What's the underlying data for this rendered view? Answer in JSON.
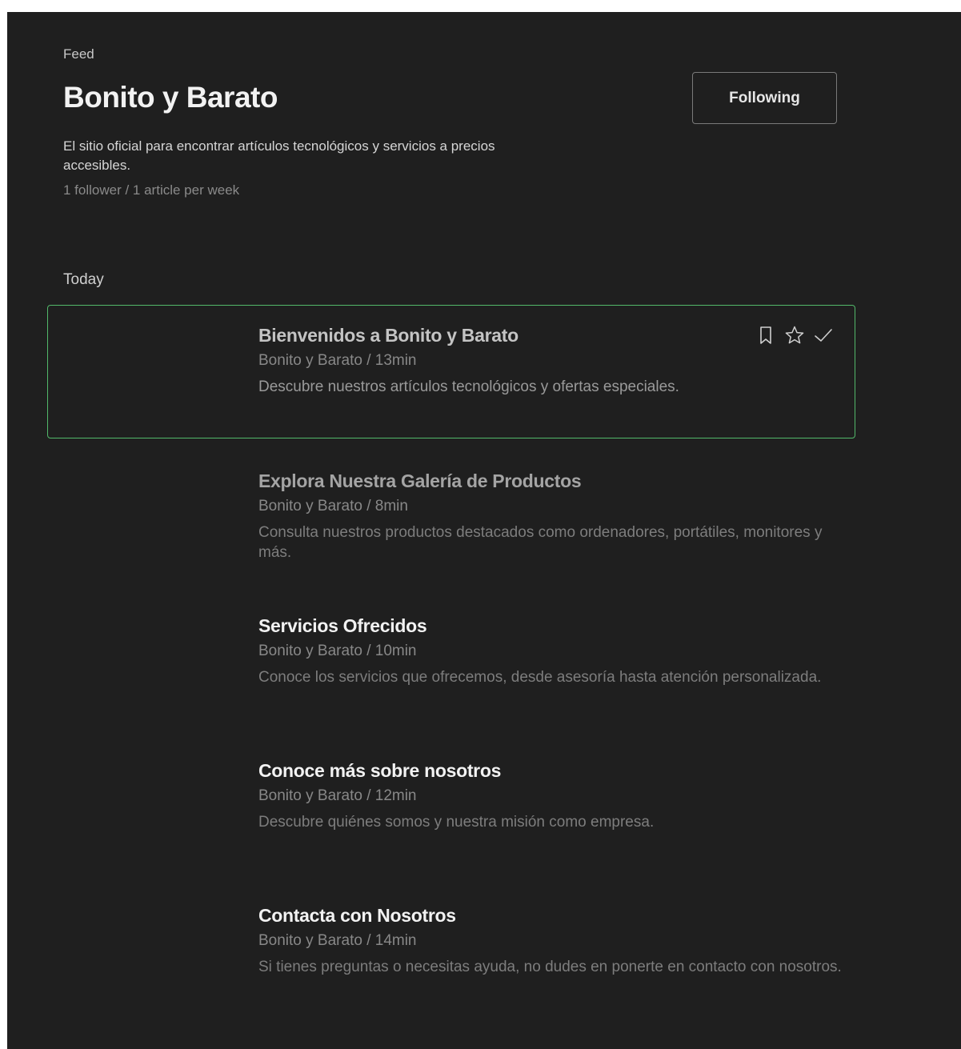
{
  "header": {
    "breadcrumb": "Feed",
    "title": "Bonito y Barato",
    "follow_button": "Following",
    "description": "El sitio oficial para encontrar artículos tecnológicos y servicios a precios accesibles.",
    "stats": "1 follower / 1 article per week"
  },
  "section": {
    "label": "Today"
  },
  "articles": [
    {
      "title": "Bienvenidos a Bonito y Barato",
      "meta": "Bonito y Barato / 13min",
      "summary": "Descubre nuestros artículos tecnológicos y ofertas especiales."
    },
    {
      "title": "Explora Nuestra Galería de Productos",
      "meta": "Bonito y Barato / 8min",
      "summary": "Consulta nuestros productos destacados como ordenadores, portátiles, monitores y más."
    },
    {
      "title": "Servicios Ofrecidos",
      "meta": "Bonito y Barato / 10min",
      "summary": "Conoce los servicios que ofrecemos, desde asesoría hasta atención personalizada."
    },
    {
      "title": "Conoce más sobre nosotros",
      "meta": "Bonito y Barato / 12min",
      "summary": "Descubre quiénes somos y nuestra misión como empresa."
    },
    {
      "title": "Contacta con Nosotros",
      "meta": "Bonito y Barato / 14min",
      "summary": "Si tienes preguntas o necesitas ayuda, no dudes en ponerte en contacto con nosotros."
    }
  ],
  "icons": {
    "bookmark": "bookmark-icon",
    "star": "star-icon",
    "check": "check-icon"
  },
  "colors": {
    "background": "#1f1f1f",
    "selected_border": "#52b86a"
  }
}
